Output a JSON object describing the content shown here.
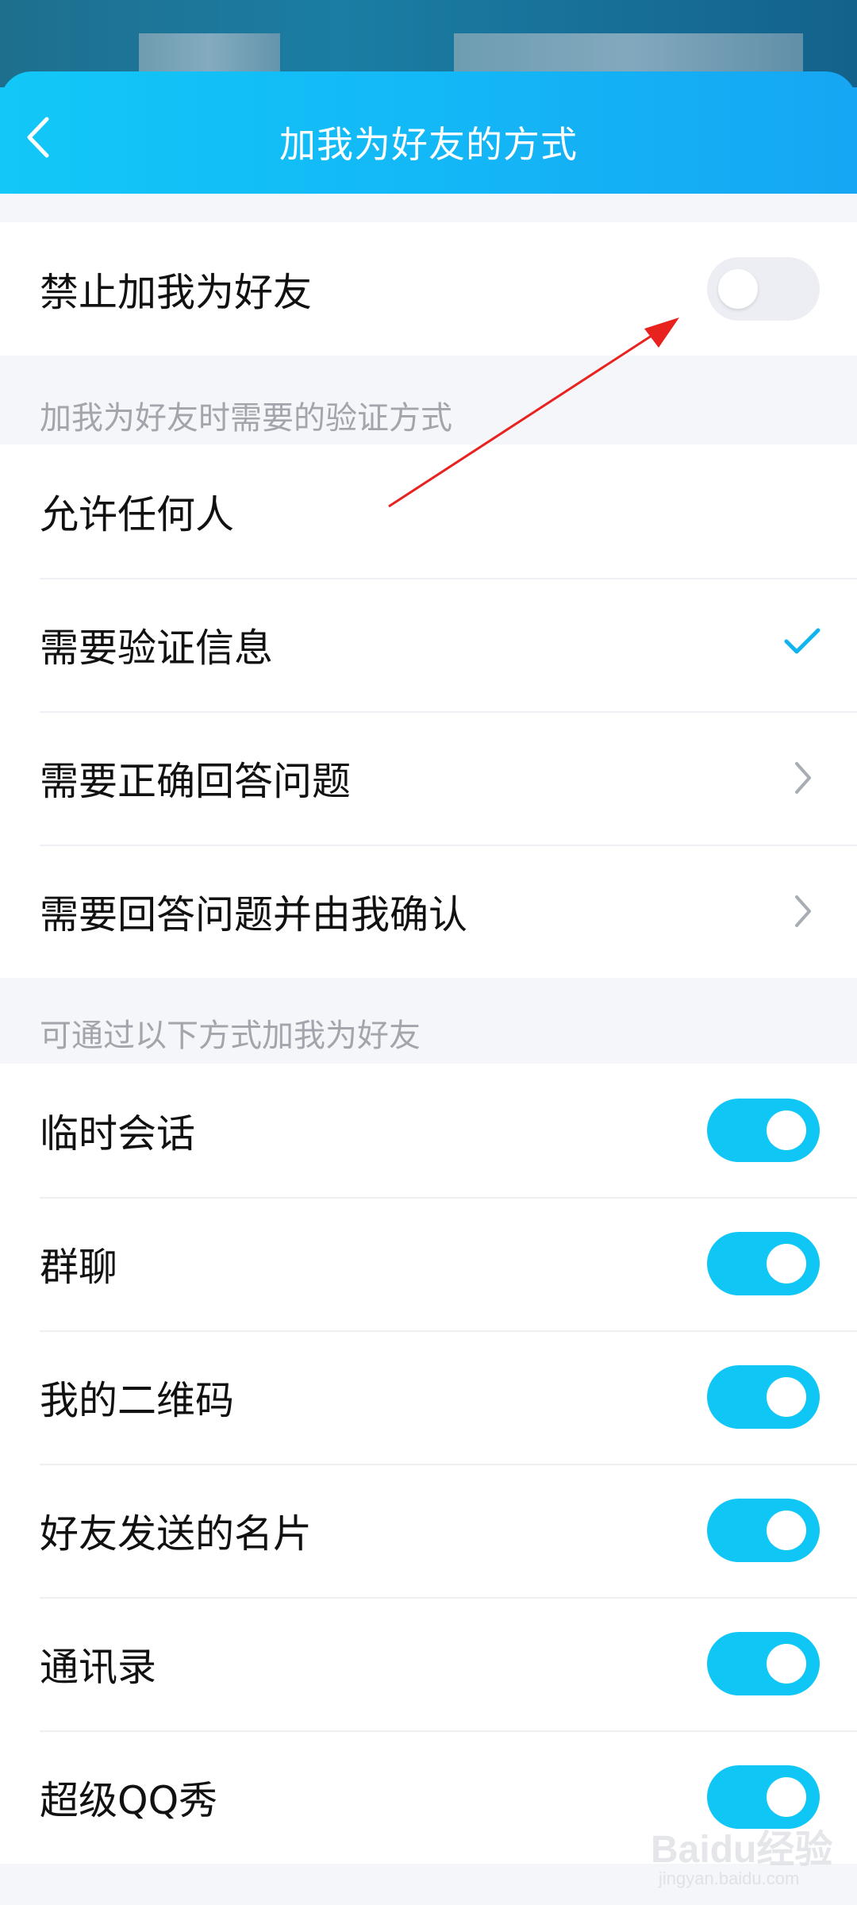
{
  "header": {
    "title": "加我为好友的方式"
  },
  "block_adding": {
    "label": "禁止加我为好友",
    "enabled": false
  },
  "verification": {
    "section_label": "加我为好友时需要的验证方式",
    "options": [
      {
        "label": "允许任何人",
        "selected": false,
        "trailing": "none"
      },
      {
        "label": "需要验证信息",
        "selected": true,
        "trailing": "check-icon"
      },
      {
        "label": "需要正确回答问题",
        "selected": false,
        "trailing": "chevron-right-icon"
      },
      {
        "label": "需要回答问题并由我确认",
        "selected": false,
        "trailing": "chevron-right-icon"
      }
    ]
  },
  "sources": {
    "section_label": "可通过以下方式加我为好友",
    "items": [
      {
        "label": "临时会话",
        "enabled": true
      },
      {
        "label": "群聊",
        "enabled": true
      },
      {
        "label": "我的二维码",
        "enabled": true
      },
      {
        "label": "好友发送的名片",
        "enabled": true
      },
      {
        "label": "通讯录",
        "enabled": true
      },
      {
        "label": "超级QQ秀",
        "enabled": true
      }
    ]
  },
  "watermark": {
    "text": "Baidu经验",
    "sub": "jingyan.baidu.com"
  },
  "colors": {
    "header_start": "#12c8f8",
    "header_end": "#16a6f3",
    "toggle_on": "#0fc6f5",
    "toggle_off": "#eceef4",
    "check": "#12b4ef",
    "annotation_arrow": "#e8231f"
  },
  "icons": {
    "back": "back-arrow-icon",
    "selected": "check-icon",
    "more": "chevron-right-icon"
  }
}
